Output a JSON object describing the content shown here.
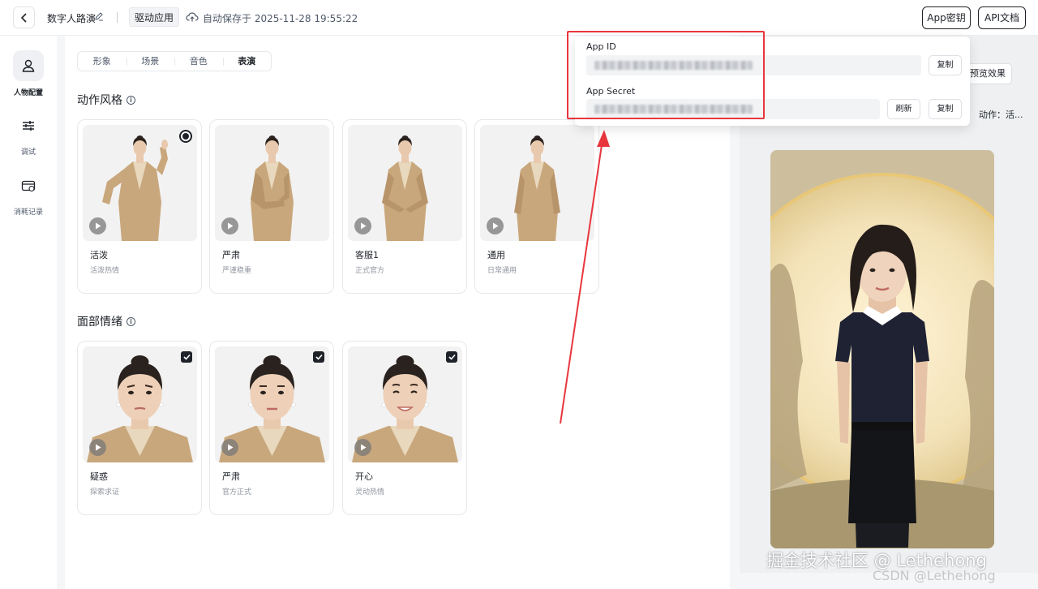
{
  "header": {
    "project_title": "数字人路演",
    "mode_tag": "驱动应用",
    "autosave_text": "自动保存于 2025-11-28 19:55:22",
    "appkey_button": "App密钥",
    "apidoc_button": "API文档"
  },
  "sidebar": {
    "items": [
      {
        "label": "人物配置",
        "icon": "person-icon",
        "active": true
      },
      {
        "label": "调试",
        "icon": "sliders-icon",
        "active": false
      },
      {
        "label": "消耗记录",
        "icon": "card-icon",
        "active": false
      }
    ]
  },
  "tabs": [
    "形象",
    "场景",
    "音色",
    "表演"
  ],
  "active_tab": "表演",
  "sections": {
    "motion_title": "动作风格",
    "face_title": "面部情绪"
  },
  "motion_cards": [
    {
      "name": "活泼",
      "desc": "活泼热情",
      "selected": true
    },
    {
      "name": "严肃",
      "desc": "严谨稳重",
      "selected": false
    },
    {
      "name": "客服1",
      "desc": "正式官方",
      "selected": false
    },
    {
      "name": "通用",
      "desc": "日常通用",
      "selected": false
    }
  ],
  "emotion_cards": [
    {
      "name": "疑惑",
      "desc": "探索求证",
      "checked": true
    },
    {
      "name": "严肃",
      "desc": "官方正式",
      "checked": true
    },
    {
      "name": "开心",
      "desc": "灵动热情",
      "checked": true
    }
  ],
  "right_panel": {
    "preview_button": "预览效果",
    "action_text": "动作：活..."
  },
  "popup": {
    "app_id_label": "App ID",
    "app_secret_label": "App Secret",
    "copy_label": "复制",
    "refresh_label": "刷新"
  },
  "watermarks": {
    "line1": "掘金技术社区 @ Lethehong",
    "line2": "CSDN @Lethehong"
  },
  "colors": {
    "highlight": "#e8363d",
    "primary_text": "#1f2329",
    "blazer": "#c9a77c",
    "outfit": "#1e2233"
  }
}
